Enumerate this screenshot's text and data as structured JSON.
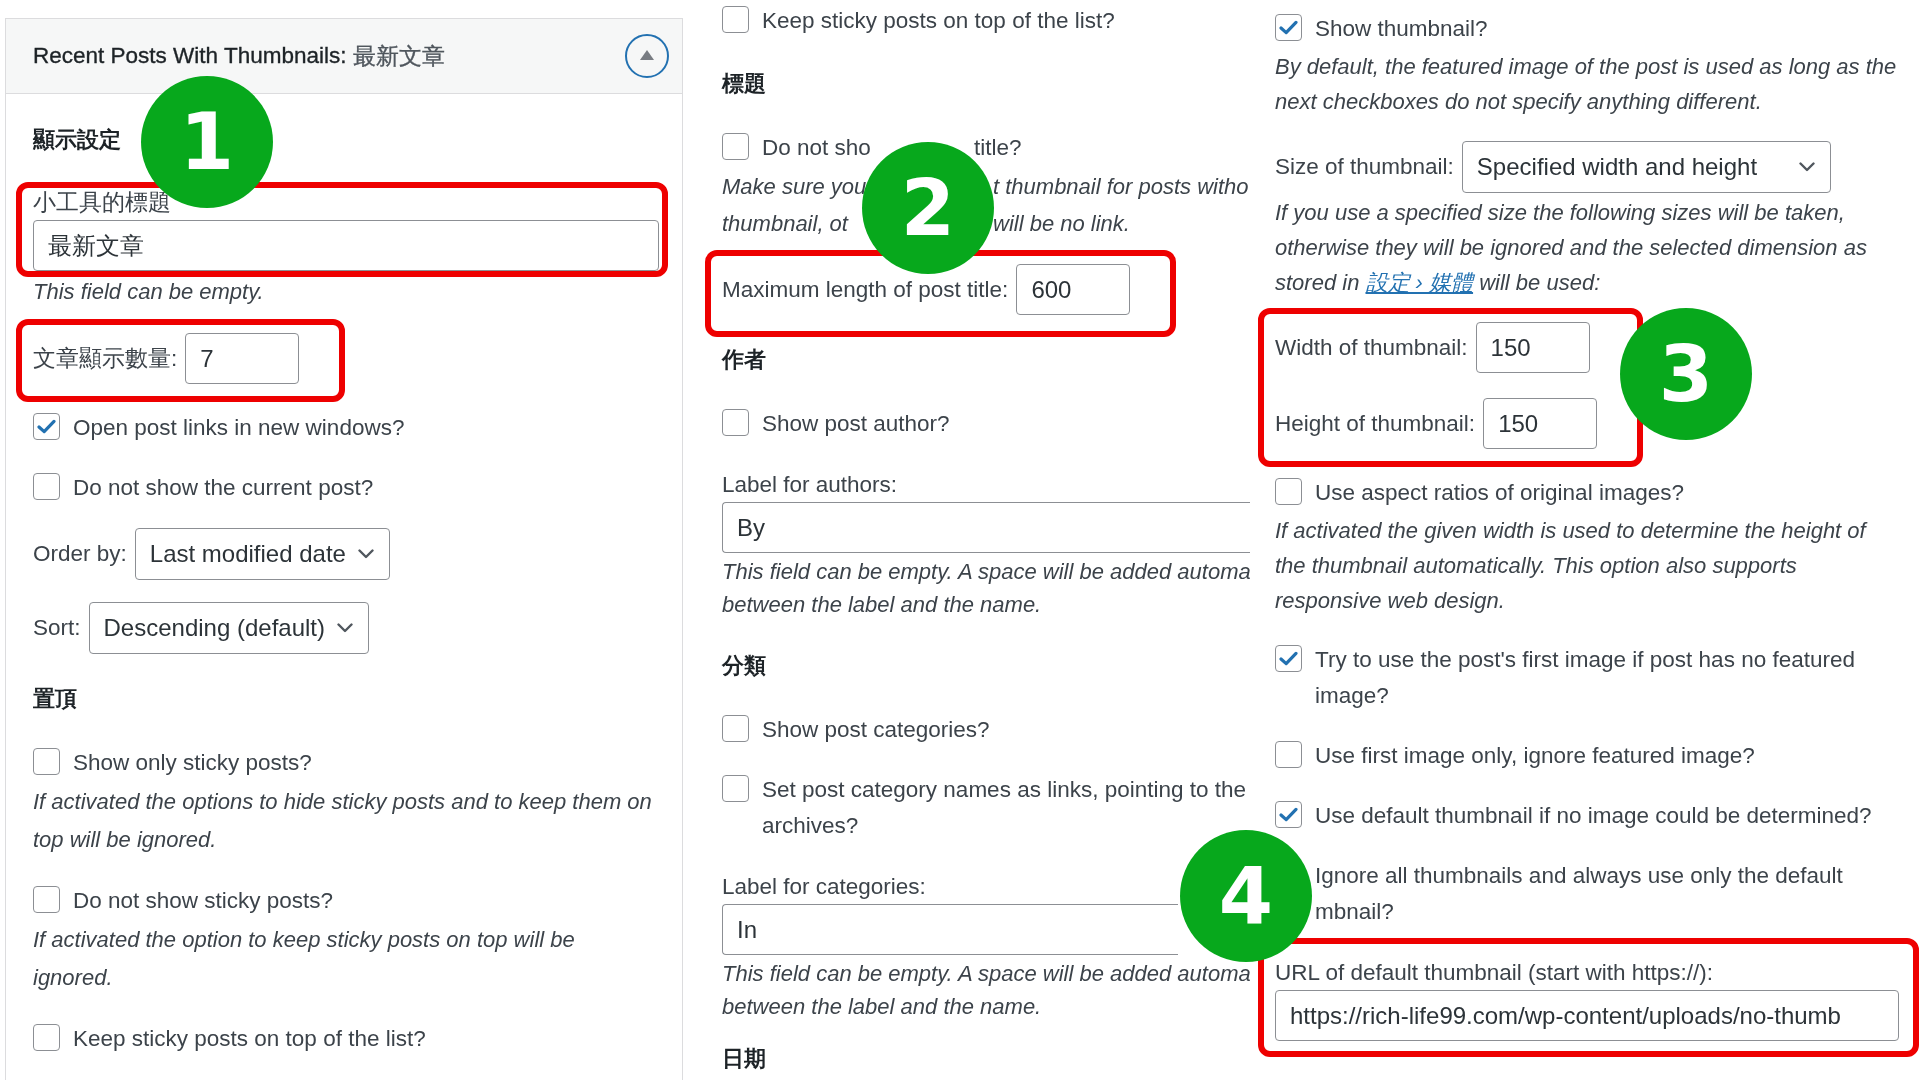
{
  "columns": [
    {
      "header": {
        "title": "Recent Posts With Thumbnails:",
        "instance_title": "最新文章",
        "expanded": true
      },
      "items": [
        {
          "kind": "heading",
          "text": "顯示設定"
        },
        {
          "kind": "group",
          "highlighted": true,
          "marker": "1",
          "items": [
            {
              "kind": "field",
              "label": "小工具的標題",
              "value": "最新文章"
            }
          ]
        },
        {
          "kind": "help",
          "lines": [
            "This field can be empty."
          ]
        },
        {
          "kind": "group",
          "highlighted": true,
          "items": [
            {
              "kind": "inline-field",
              "label": "文章顯示數量:",
              "value": "7"
            }
          ]
        },
        {
          "kind": "checkbox",
          "lines": [
            "Open post links in new windows?"
          ],
          "checked": true
        },
        {
          "kind": "checkbox",
          "lines": [
            "Do not show the current post?"
          ],
          "checked": false
        },
        {
          "kind": "select",
          "label": "Order by:",
          "value": "Last modified date"
        },
        {
          "kind": "select",
          "label": "Sort:",
          "value": "Descending (default)"
        },
        {
          "kind": "heading",
          "text": "置頂"
        },
        {
          "kind": "checkbox",
          "lines": [
            "Show only sticky posts?"
          ],
          "checked": false
        },
        {
          "kind": "help",
          "lines": [
            "If activated the options to hide sticky posts and to keep them on",
            "top will be ignored."
          ]
        },
        {
          "kind": "checkbox",
          "lines": [
            "Do not show sticky posts?"
          ],
          "checked": false
        },
        {
          "kind": "help",
          "lines": [
            "If activated the option to keep sticky posts on top will be",
            "ignored."
          ]
        },
        {
          "kind": "checkbox",
          "lines": [
            "Keep sticky posts on top of the list?"
          ],
          "checked": false
        }
      ]
    },
    {
      "items": [
        {
          "kind": "checkbox",
          "lines": [
            "Keep sticky posts on top of the list?"
          ],
          "checked": false
        },
        {
          "kind": "heading",
          "text": "標題"
        },
        {
          "kind": "checkbox-split",
          "left": "Do not sho",
          "right": "title?",
          "checked": false
        },
        {
          "kind": "help-split",
          "lines": [
            {
              "left": "Make sure you",
              "right": "t thumbnail for posts witho"
            },
            {
              "left": "thumbnail, ot",
              "right": "will be no link."
            }
          ]
        },
        {
          "kind": "group",
          "highlighted": true,
          "marker": "2",
          "items": [
            {
              "kind": "inline-field",
              "label": "Maximum length of post title:",
              "value": "600"
            }
          ]
        },
        {
          "kind": "heading",
          "text": "作者"
        },
        {
          "kind": "checkbox",
          "lines": [
            "Show post author?"
          ],
          "checked": false
        },
        {
          "kind": "field",
          "label": "Label for authors:",
          "value": "By"
        },
        {
          "kind": "help",
          "lines": [
            "This field can be empty. A space will be added automa",
            "between the label and the name."
          ]
        },
        {
          "kind": "heading",
          "text": "分類"
        },
        {
          "kind": "checkbox",
          "lines": [
            "Show post categories?"
          ],
          "checked": false
        },
        {
          "kind": "checkbox",
          "lines": [
            "Set post category names as links, pointing to the",
            "archives?"
          ],
          "checked": false
        },
        {
          "kind": "field",
          "label": "Label for categories:",
          "value": "In"
        },
        {
          "kind": "help",
          "lines": [
            "This field can be empty. A space will be added automa",
            "between the label and the name."
          ]
        },
        {
          "kind": "heading",
          "text": "日期"
        }
      ]
    },
    {
      "items": [
        {
          "kind": "checkbox",
          "lines": [
            "Show thumbnail?"
          ],
          "checked": true
        },
        {
          "kind": "help",
          "lines": [
            "By default, the featured image of the post is used as long as the",
            "next checkboxes do not specify anything different."
          ]
        },
        {
          "kind": "select",
          "label": "Size of thumbnail:",
          "value": "Specified width and height"
        },
        {
          "kind": "help-link",
          "lines": [
            "If you use a specified size the following sizes will be taken,",
            "otherwise they will be ignored and the selected dimension as"
          ],
          "before_link": "stored in",
          "link": "設定 › 媒體",
          "after_link": "will be used:"
        },
        {
          "kind": "group",
          "highlighted": true,
          "marker": "3",
          "items": [
            {
              "kind": "inline-field",
              "label": "Width of thumbnail:",
              "value": "150"
            },
            {
              "kind": "inline-field",
              "label": "Height of thumbnail:",
              "value": "150"
            }
          ]
        },
        {
          "kind": "checkbox",
          "lines": [
            "Use aspect ratios of original images?"
          ],
          "checked": false
        },
        {
          "kind": "help",
          "lines": [
            "If activated the given width is used to determine the height of",
            "the thumbnail automatically. This option also supports",
            "responsive web design."
          ]
        },
        {
          "kind": "checkbox",
          "lines": [
            "Try to use the post's first image if post has no featured",
            "image?"
          ],
          "checked": true
        },
        {
          "kind": "checkbox",
          "lines": [
            "Use first image only, ignore featured image?"
          ],
          "checked": false
        },
        {
          "kind": "checkbox",
          "lines": [
            "Use default thumbnail if no image could be determined?"
          ],
          "checked": true
        },
        {
          "kind": "covered-option",
          "lines": [
            "Ignore all thumbnails and always use only the default",
            "mbnail?"
          ]
        },
        {
          "kind": "group",
          "highlighted": true,
          "marker": "4",
          "items": [
            {
              "kind": "field",
              "label": "URL of default thumbnail (start with https://):",
              "value": "https://rich-life99.com/wp-content/uploads/no-thumb"
            }
          ]
        }
      ]
    }
  ]
}
